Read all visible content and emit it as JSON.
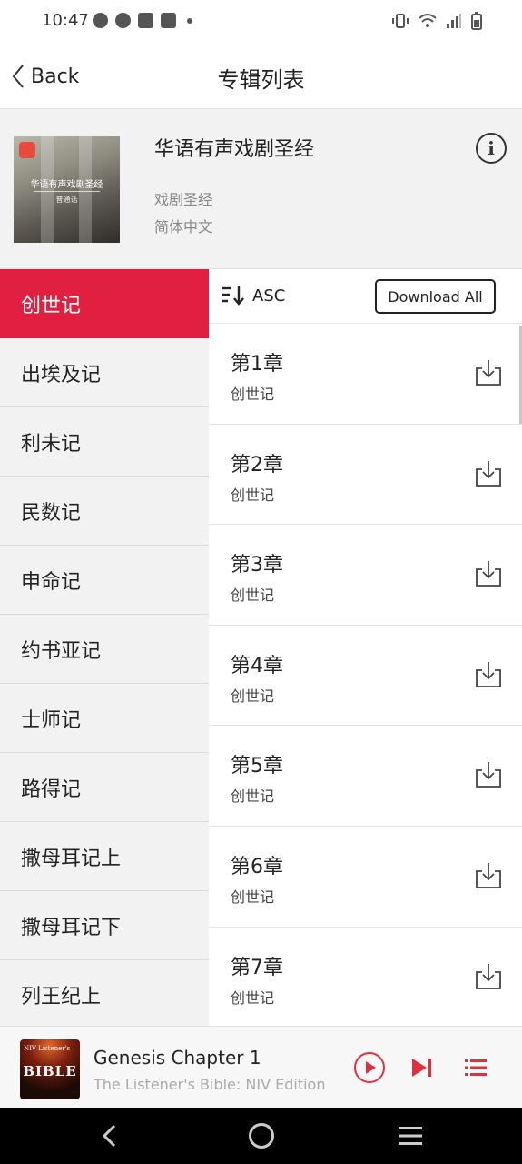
{
  "status_bar": {
    "time": "10:47",
    "left_icons": [
      "chat-bubble-icon",
      "check-badge-icon",
      "mail-icon",
      "mail-icon",
      "dot-icon"
    ],
    "right_icons": [
      "vibrate-icon",
      "wifi-icon",
      "signal-icon",
      "battery-icon"
    ]
  },
  "header": {
    "back_label": "Back",
    "title": "专辑列表"
  },
  "album": {
    "cover_text": "华语有声戏剧圣经",
    "cover_subtext": "普通话",
    "title": "华语有声戏剧圣经",
    "genre": "戏剧圣经",
    "language": "简体中文",
    "info_icon": "info-icon"
  },
  "books": [
    {
      "label": "创世记",
      "active": true
    },
    {
      "label": "出埃及记",
      "active": false
    },
    {
      "label": "利未记",
      "active": false
    },
    {
      "label": "民数记",
      "active": false
    },
    {
      "label": "申命记",
      "active": false
    },
    {
      "label": "约书亚记",
      "active": false
    },
    {
      "label": "士师记",
      "active": false
    },
    {
      "label": "路得记",
      "active": false
    },
    {
      "label": "撒母耳记上",
      "active": false
    },
    {
      "label": "撒母耳记下",
      "active": false
    },
    {
      "label": "列王纪上",
      "active": false
    }
  ],
  "toolbar": {
    "sort_label": "ASC",
    "download_all_label": "Download All"
  },
  "chapters": [
    {
      "title": "第1章",
      "book": "创世记"
    },
    {
      "title": "第2章",
      "book": "创世记"
    },
    {
      "title": "第3章",
      "book": "创世记"
    },
    {
      "title": "第4章",
      "book": "创世记"
    },
    {
      "title": "第5章",
      "book": "创世记"
    },
    {
      "title": "第6章",
      "book": "创世记"
    },
    {
      "title": "第7章",
      "book": "创世记"
    }
  ],
  "player": {
    "cover_top_text": "NIV Listener's",
    "cover_big_text": "BIBLE",
    "track_title": "Genesis Chapter 1",
    "track_subtitle": "The Listener's Bible: NIV Edition"
  },
  "colors": {
    "accent": "#e11f40",
    "player_accent": "#e0303f",
    "sidebar_bg": "#f2f2f2"
  }
}
